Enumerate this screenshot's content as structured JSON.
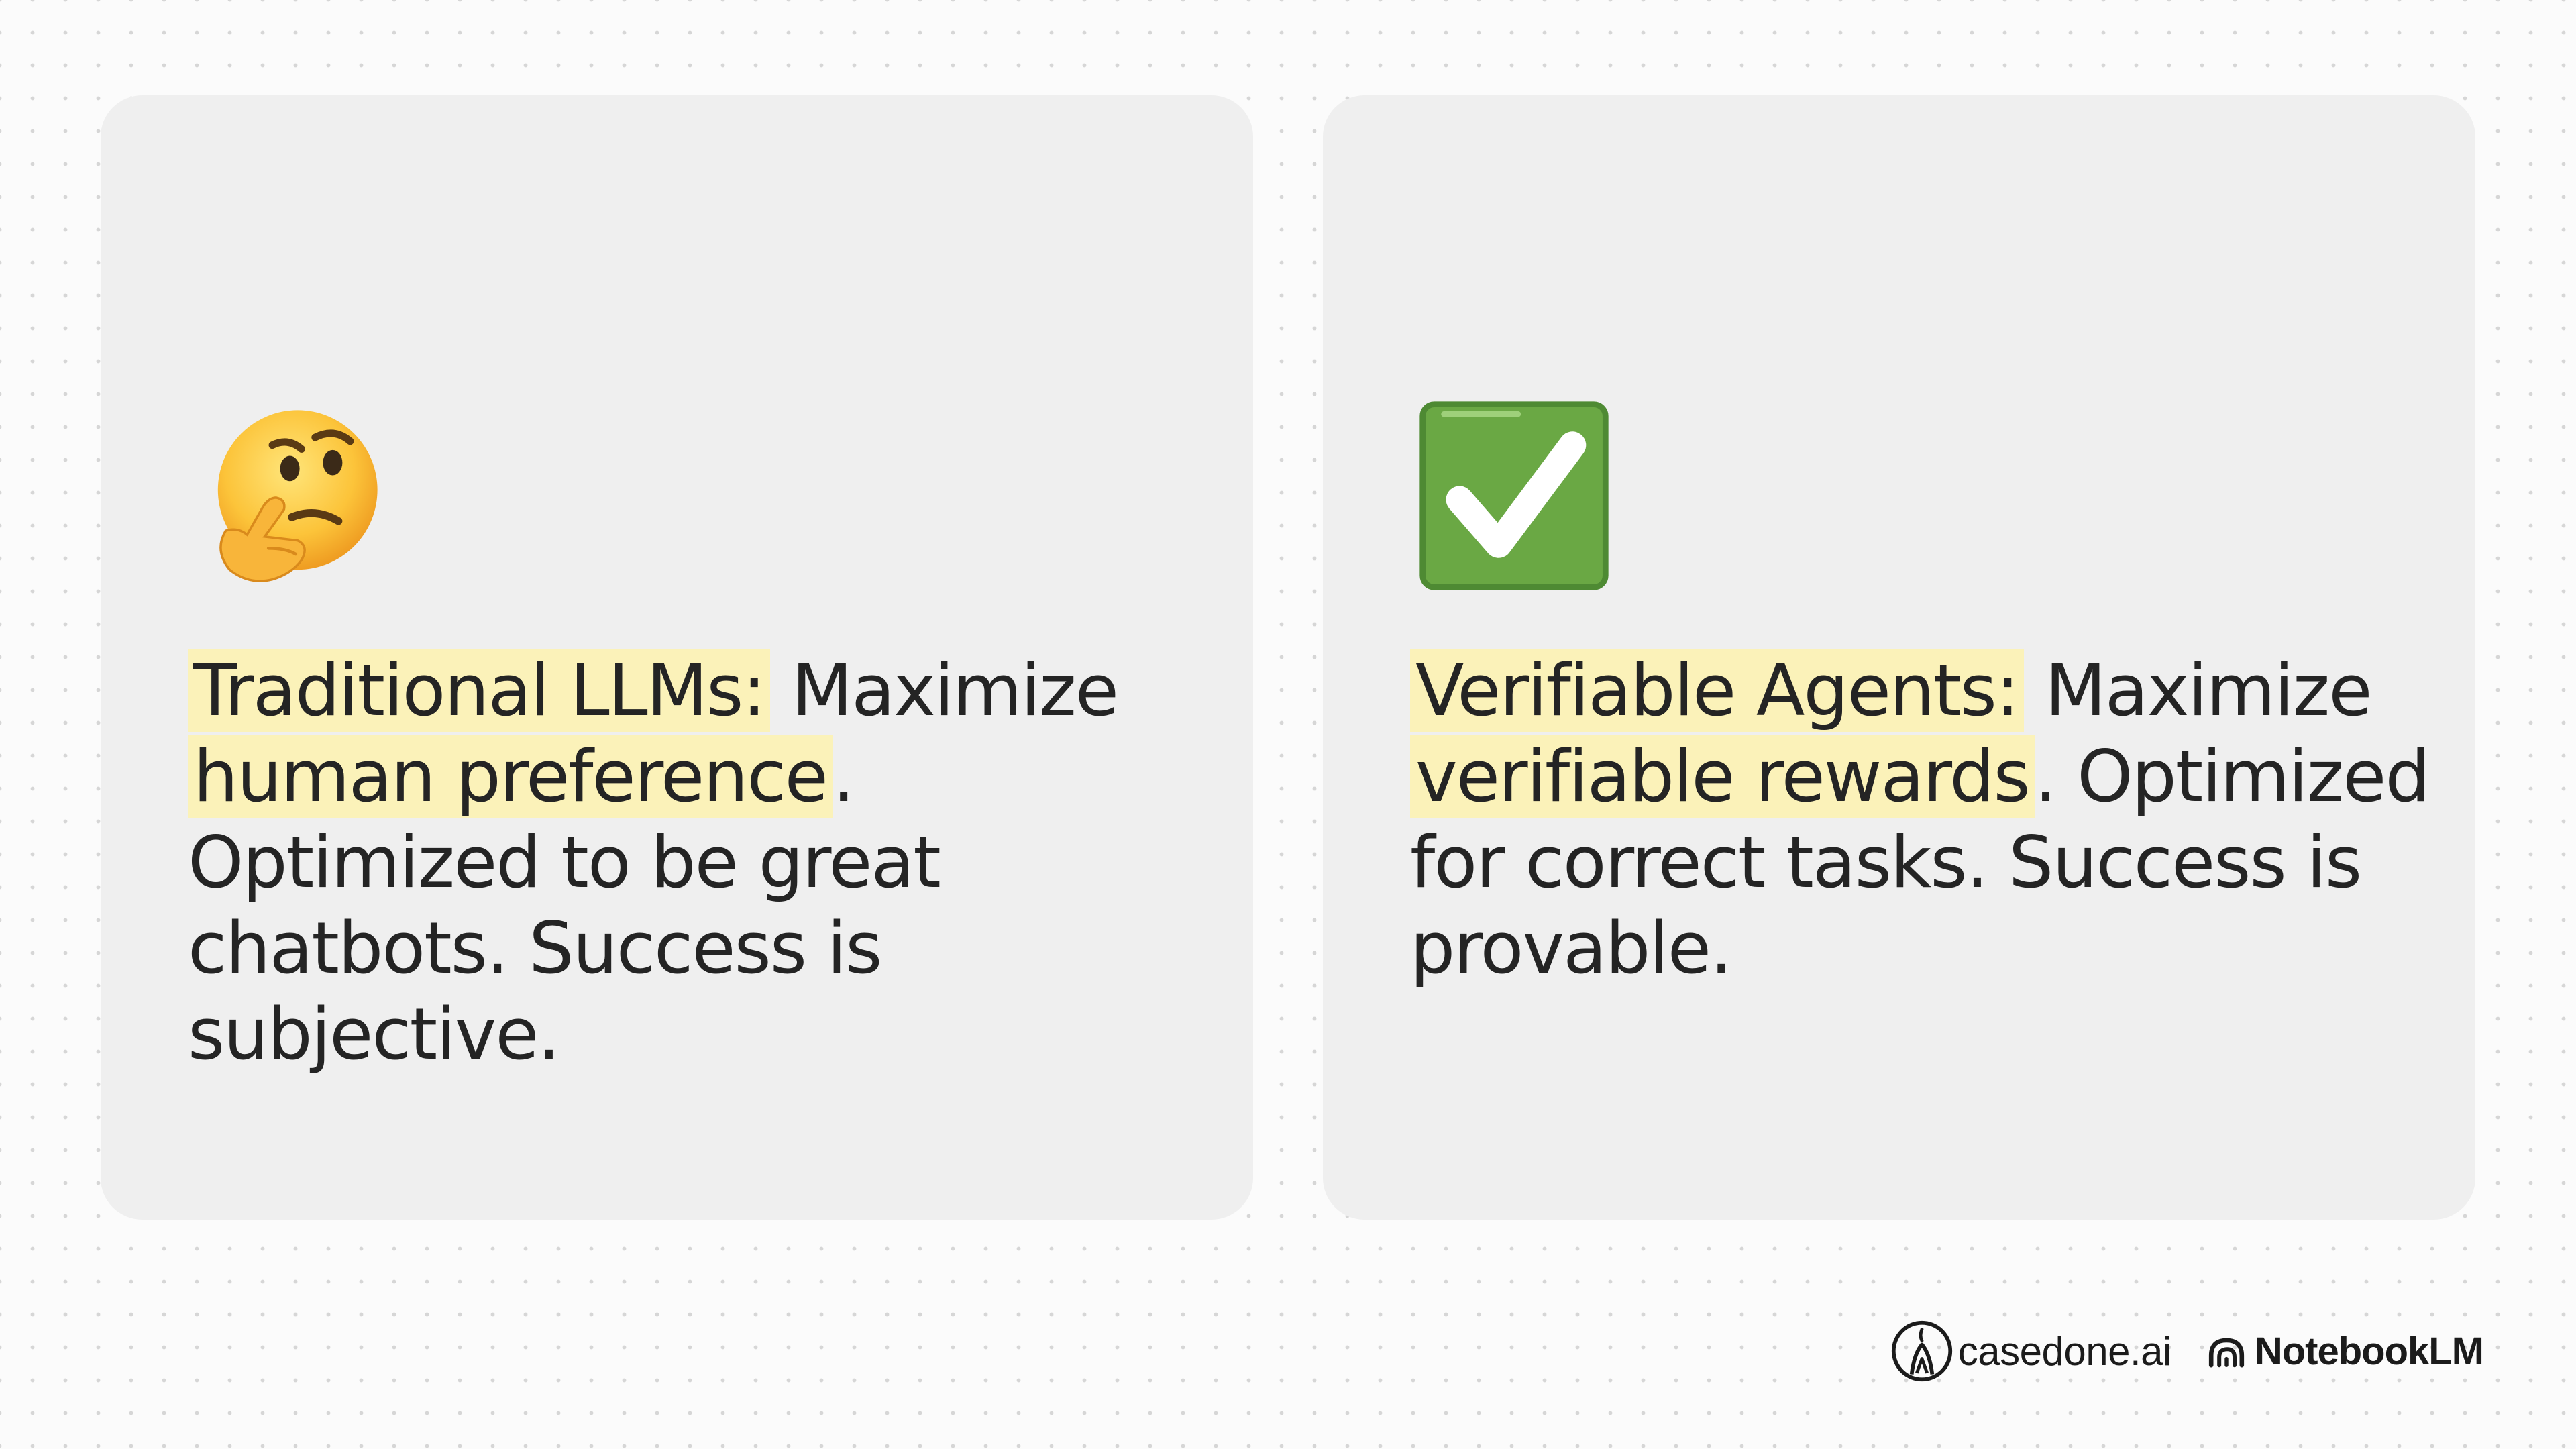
{
  "cards": [
    {
      "emoji": "thinking-face-icon",
      "highlight_label": "Traditional LLMs:",
      "lead_text": " Maximize ",
      "highlight_phrase": "human preference",
      "tail_text": ". Optimized to be great chatbots. Success is subjective."
    },
    {
      "emoji": "check-mark-button-icon",
      "highlight_label": "Verifiable Agents:",
      "lead_text": " Maximize ",
      "highlight_phrase": "verifiable rewards",
      "tail_text": ". Optimized for correct tasks. Success is provable."
    }
  ],
  "colors": {
    "highlight": "#fbf2b9",
    "card_background": "#efefef",
    "check_green": "#6aa844"
  },
  "footer": {
    "brand1": {
      "icon": "casedone-logo-icon",
      "name": "casedone.ai"
    },
    "brand2": {
      "icon": "notebooklm-logo-icon",
      "name": "NotebookLM"
    }
  }
}
